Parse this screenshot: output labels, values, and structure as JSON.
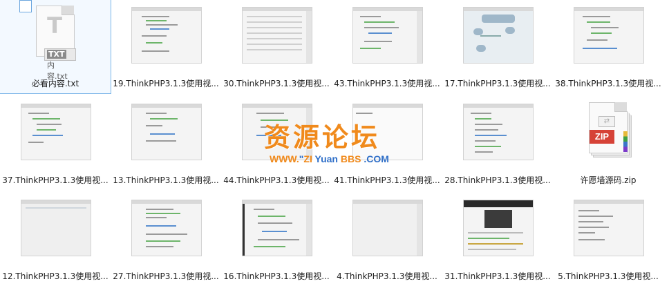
{
  "files": [
    {
      "id": "r1c1",
      "type": "txt",
      "label": "必看内容.txt",
      "icon": "txt-file-icon",
      "icon_text": "TXT",
      "icon_caption": "内容.txt",
      "selected": true
    },
    {
      "id": "r1c2",
      "type": "video",
      "label": "19.ThinkPHP3.1.3使用视..."
    },
    {
      "id": "r1c3",
      "type": "video",
      "label": "30.ThinkPHP3.1.3使用视..."
    },
    {
      "id": "r1c4",
      "type": "video",
      "label": "43.ThinkPHP3.1.3使用视..."
    },
    {
      "id": "r1c5",
      "type": "video",
      "label": "17.ThinkPHP3.1.3使用视..."
    },
    {
      "id": "r1c6",
      "type": "video",
      "label": "38.ThinkPHP3.1.3使用视..."
    },
    {
      "id": "r2c1",
      "type": "video",
      "label": "37.ThinkPHP3.1.3使用视..."
    },
    {
      "id": "r2c2",
      "type": "video",
      "label": "13.ThinkPHP3.1.3使用视..."
    },
    {
      "id": "r2c3",
      "type": "video",
      "label": "44.ThinkPHP3.1.3使用视..."
    },
    {
      "id": "r2c4",
      "type": "video",
      "label": "41.ThinkPHP3.1.3使用视..."
    },
    {
      "id": "r2c5",
      "type": "video",
      "label": "28.ThinkPHP3.1.3使用视..."
    },
    {
      "id": "r2c6",
      "type": "zip",
      "label": "许愿墙源码.zip",
      "icon": "zip-file-icon",
      "icon_text": "ZIP"
    },
    {
      "id": "r3c1",
      "type": "video",
      "label": "12.ThinkPHP3.1.3使用视..."
    },
    {
      "id": "r3c2",
      "type": "video",
      "label": "27.ThinkPHP3.1.3使用视..."
    },
    {
      "id": "r3c3",
      "type": "video",
      "label": "16.ThinkPHP3.1.3使用视..."
    },
    {
      "id": "r3c4",
      "type": "video",
      "label": "4.ThinkPHP3.1.3使用视..."
    },
    {
      "id": "r3c5",
      "type": "video",
      "label": "31.ThinkPHP3.1.3使用视..."
    },
    {
      "id": "r3c6",
      "type": "video",
      "label": "5.ThinkPHP3.1.3使用视..."
    }
  ],
  "watermark": {
    "title": "资源论坛",
    "url_prefix": "WWW.",
    "url_zi": "ZI",
    "url_yuan": "Yuan",
    "url_bbs": "BBS",
    "url_suffix": ".COM",
    "colors": {
      "orange": "#f08a1c",
      "blue": "#2f6fc8"
    }
  }
}
